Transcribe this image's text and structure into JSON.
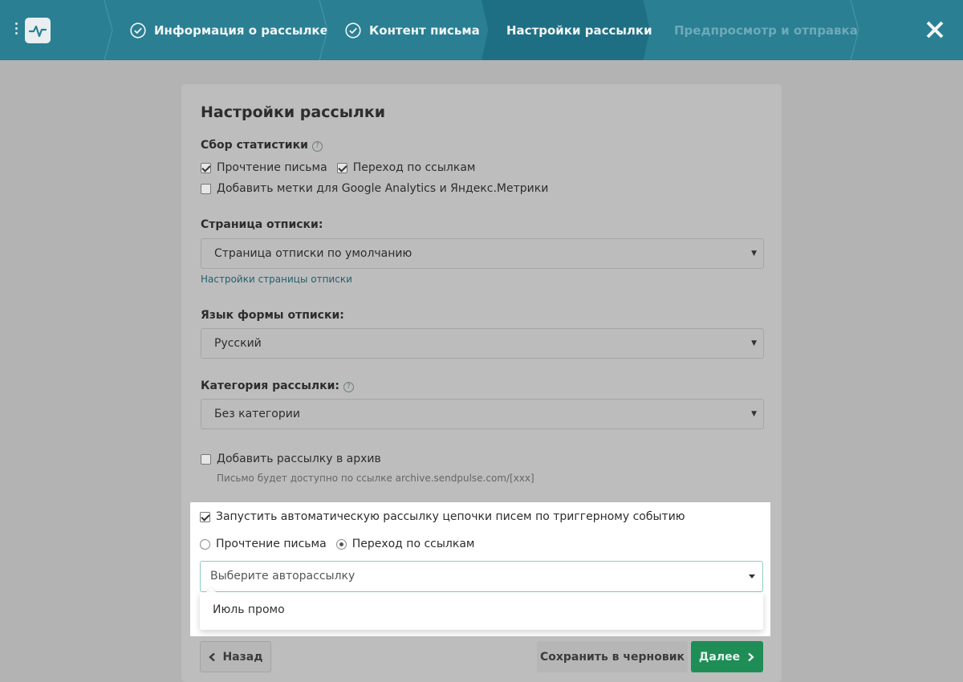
{
  "header": {
    "steps": [
      {
        "label": "Информация о рассылке",
        "state": "done"
      },
      {
        "label": "Контент письма",
        "state": "done"
      },
      {
        "label": "Настройки рассылки",
        "state": "active"
      },
      {
        "label": "Предпросмотр и отправка",
        "state": "pending"
      }
    ],
    "colors": {
      "bar": "#2a7f93",
      "active": "#1f6f84"
    }
  },
  "card": {
    "title": "Настройки рассылки",
    "stats": {
      "label": "Сбор статистики",
      "read": {
        "label": "Прочтение письма",
        "checked": true
      },
      "clicks": {
        "label": "Переход по ссылкам",
        "checked": true
      },
      "utm": {
        "label": "Добавить метки для Google Analytics и Яндекс.Метрики",
        "checked": false
      }
    },
    "unsub_page": {
      "label": "Страница отписки:",
      "value": "Страница отписки по умолчанию",
      "link": "Настройки страницы отписки"
    },
    "unsub_lang": {
      "label": "Язык формы отписки:",
      "value": "Русский"
    },
    "category": {
      "label": "Категория рассылки:",
      "value": "Без категории"
    },
    "archive": {
      "label": "Добавить рассылку в архив",
      "checked": false,
      "hint": "Письмо будет доступно по ссылке archive.sendpulse.com/[xxx]"
    }
  },
  "trigger": {
    "label": "Запустить автоматическую рассылку цепочки писем по триггерному событию",
    "checked": true,
    "radio_read": {
      "label": "Прочтение письма",
      "selected": false
    },
    "radio_clicks": {
      "label": "Переход по ссылкам",
      "selected": true
    },
    "select_placeholder": "Выберите авторассылку",
    "options": [
      "Июль промо"
    ]
  },
  "footer": {
    "back": "Назад",
    "save_draft": "Сохранить в черновик",
    "next": "Далее",
    "next_color": "#1f8d56"
  }
}
